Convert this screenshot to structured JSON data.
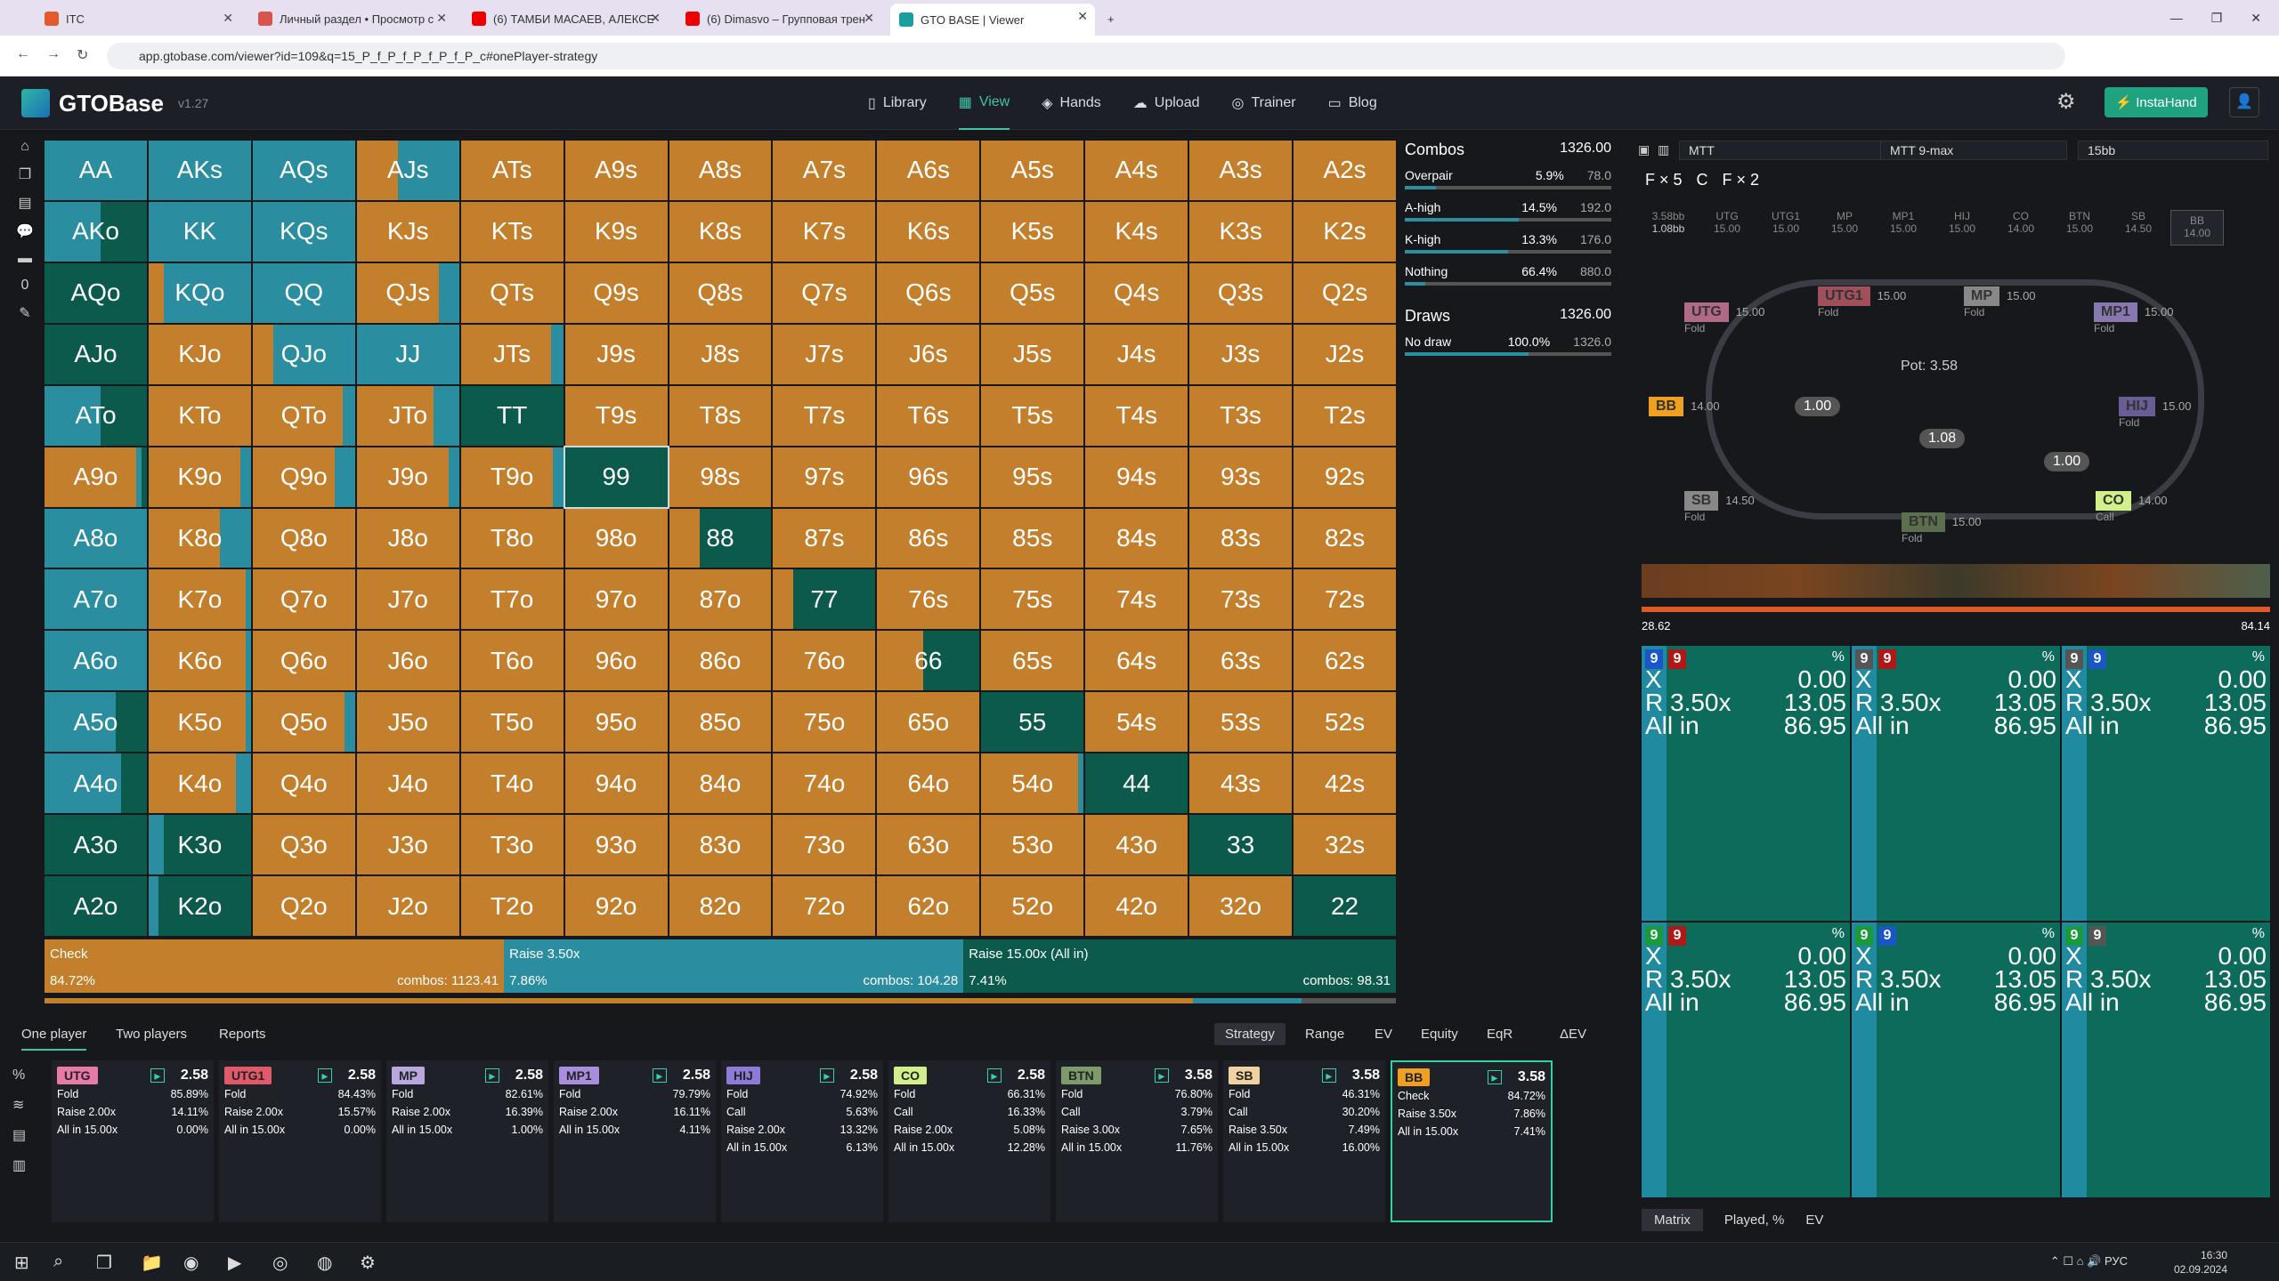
{
  "browser": {
    "tabs": [
      {
        "label": "ITC",
        "color": "#e55a2b",
        "active": false
      },
      {
        "label": "Личный раздел • Просмотр с",
        "color": "#d9534f",
        "active": false
      },
      {
        "label": "(6) ТАМБИ МАСАЕВ, АЛЕКСЕЙ",
        "color": "#e00",
        "active": false
      },
      {
        "label": "(6) Dimasvo – Групповая трен",
        "color": "#e00",
        "active": false
      },
      {
        "label": "GTO BASE | Viewer",
        "color": "#1b9e9e",
        "active": true
      }
    ],
    "url": "app.gtobase.com/viewer?id=109&q=15_P_f_P_f_P_f_P_f_P_c#onePlayer-strategy"
  },
  "app": {
    "name": "GTOBase",
    "version": "v1.27",
    "nav": [
      "Library",
      "View",
      "Hands",
      "Upload",
      "Trainer",
      "Blog"
    ],
    "nav_selected": "View",
    "instahand": "InstaHand"
  },
  "matrix": {
    "colors": {
      "check": "#c47f2c",
      "raise": "#2a8ea0",
      "allin": "#0b5a4c"
    },
    "hands": [
      "AA",
      "AKs",
      "AQs",
      "AJs",
      "ATs",
      "A9s",
      "A8s",
      "A7s",
      "A6s",
      "A5s",
      "A4s",
      "A3s",
      "A2s",
      "AKo",
      "KK",
      "KQs",
      "KJs",
      "KTs",
      "K9s",
      "K8s",
      "K7s",
      "K6s",
      "K5s",
      "K4s",
      "K3s",
      "K2s",
      "AQo",
      "KQo",
      "QQ",
      "QJs",
      "QTs",
      "Q9s",
      "Q8s",
      "Q7s",
      "Q6s",
      "Q5s",
      "Q4s",
      "Q3s",
      "Q2s",
      "AJo",
      "KJo",
      "QJo",
      "JJ",
      "JTs",
      "J9s",
      "J8s",
      "J7s",
      "J6s",
      "J5s",
      "J4s",
      "J3s",
      "J2s",
      "ATo",
      "KTo",
      "QTo",
      "JTo",
      "TT",
      "T9s",
      "T8s",
      "T7s",
      "T6s",
      "T5s",
      "T4s",
      "T3s",
      "T2s",
      "A9o",
      "K9o",
      "Q9o",
      "J9o",
      "T9o",
      "99",
      "98s",
      "97s",
      "96s",
      "95s",
      "94s",
      "93s",
      "92s",
      "A8o",
      "K8o",
      "Q8o",
      "J8o",
      "T8o",
      "98o",
      "88",
      "87s",
      "86s",
      "85s",
      "84s",
      "83s",
      "82s",
      "A7o",
      "K7o",
      "Q7o",
      "J7o",
      "T7o",
      "97o",
      "87o",
      "77",
      "76s",
      "75s",
      "74s",
      "73s",
      "72s",
      "A6o",
      "K6o",
      "Q6o",
      "J6o",
      "T6o",
      "96o",
      "86o",
      "76o",
      "66",
      "65s",
      "64s",
      "63s",
      "62s",
      "A5o",
      "K5o",
      "Q5o",
      "J5o",
      "T5o",
      "95o",
      "85o",
      "75o",
      "65o",
      "55",
      "54s",
      "53s",
      "52s",
      "A4o",
      "K4o",
      "Q4o",
      "J4o",
      "T4o",
      "94o",
      "84o",
      "74o",
      "64o",
      "54o",
      "44",
      "43s",
      "42s",
      "A3o",
      "K3o",
      "Q3o",
      "J3o",
      "T3o",
      "93o",
      "83o",
      "73o",
      "63o",
      "53o",
      "43o",
      "33",
      "32s",
      "A2o",
      "K2o",
      "Q2o",
      "J2o",
      "T2o",
      "92o",
      "82o",
      "72o",
      "62o",
      "52o",
      "42o",
      "32o",
      "22"
    ],
    "mix": {
      "AA": [
        0,
        100,
        0
      ],
      "AKs": [
        0,
        100,
        0
      ],
      "AQs": [
        0,
        100,
        0
      ],
      "AJs": [
        40,
        60,
        0
      ],
      "ATs": [
        100,
        0,
        0
      ],
      "AKo": [
        0,
        55,
        45
      ],
      "KK": [
        0,
        100,
        0
      ],
      "KQs": [
        0,
        100,
        0
      ],
      "KJs": [
        100,
        0,
        0
      ],
      "KTs": [
        100,
        0,
        0
      ],
      "AQo": [
        0,
        0,
        100
      ],
      "KQo": [
        15,
        85,
        0
      ],
      "QQ": [
        0,
        100,
        0
      ],
      "QJs": [
        80,
        20,
        0
      ],
      "QTs": [
        100,
        0,
        0
      ],
      "AJo": [
        0,
        0,
        100
      ],
      "KJo": [
        100,
        0,
        0
      ],
      "QJo": [
        20,
        80,
        0
      ],
      "JJ": [
        0,
        100,
        0
      ],
      "JTs": [
        88,
        12,
        0
      ],
      "ATo": [
        0,
        55,
        45
      ],
      "KTo": [
        100,
        0,
        0
      ],
      "QTo": [
        88,
        12,
        0
      ],
      "JTo": [
        75,
        25,
        0
      ],
      "TT": [
        0,
        0,
        100
      ],
      "A9o": [
        90,
        5,
        5
      ],
      "K9o": [
        90,
        10,
        0
      ],
      "Q9o": [
        80,
        20,
        0
      ],
      "J9o": [
        90,
        10,
        0
      ],
      "T9o": [
        90,
        10,
        0
      ],
      "99": [
        0,
        0,
        100
      ],
      "A8o": [
        0,
        100,
        0
      ],
      "K8o": [
        70,
        30,
        0
      ],
      "88": [
        30,
        0,
        70
      ],
      "A7o": [
        0,
        100,
        0
      ],
      "K7o": [
        95,
        5,
        0
      ],
      "77": [
        20,
        0,
        80
      ],
      "A6o": [
        0,
        100,
        0
      ],
      "K6o": [
        95,
        5,
        0
      ],
      "66": [
        45,
        0,
        55
      ],
      "A5o": [
        0,
        70,
        30
      ],
      "K5o": [
        95,
        5,
        0
      ],
      "Q5o": [
        90,
        10,
        0
      ],
      "55": [
        0,
        0,
        100
      ],
      "A4o": [
        0,
        75,
        25
      ],
      "K4o": [
        85,
        15,
        0
      ],
      "54o": [
        95,
        5,
        0
      ],
      "44": [
        0,
        0,
        100
      ],
      "A3o": [
        0,
        0,
        100
      ],
      "K3o": [
        0,
        15,
        85
      ],
      "Q3o": [
        100,
        0,
        0
      ],
      "33": [
        0,
        0,
        100
      ],
      "A2o": [
        0,
        0,
        100
      ],
      "K2o": [
        0,
        10,
        90
      ],
      "Q2o": [
        100,
        0,
        0
      ],
      "22": [
        0,
        0,
        100
      ]
    },
    "highlighted": "99"
  },
  "actions": [
    {
      "label": "Check",
      "pct": "84.72%",
      "combos": "combos: 1123.41",
      "color": "#c47f2c",
      "width": 34
    },
    {
      "label": "Raise 3.50x",
      "pct": "7.86%",
      "combos": "combos: 104.28",
      "color": "#2a8ea0",
      "width": 34
    },
    {
      "label": "Raise 15.00x (All in)",
      "pct": "7.41%",
      "combos": "combos: 98.31",
      "color": "#0b5a4c",
      "width": 32
    }
  ],
  "combos": {
    "title": "Combos",
    "total": "1326.00",
    "rows": [
      {
        "label": "Overpair",
        "pct": "5.9%",
        "n": "78.0",
        "fill": 15
      },
      {
        "label": "A-high",
        "pct": "14.5%",
        "n": "192.0",
        "fill": 55
      },
      {
        "label": "K-high",
        "pct": "13.3%",
        "n": "176.0",
        "fill": 50
      },
      {
        "label": "Nothing",
        "pct": "66.4%",
        "n": "880.0",
        "fill": 10
      }
    ],
    "draws_title": "Draws",
    "draws_total": "1326.00",
    "draws": [
      {
        "label": "No draw",
        "pct": "100.0%",
        "n": "1326.0",
        "fill": 60
      }
    ]
  },
  "tabs": {
    "left": [
      "One player",
      "Two players",
      "Reports"
    ],
    "left_selected": "One player",
    "right": [
      "Strategy",
      "Range",
      "EV",
      "Equity",
      "EqR",
      "ΔEV"
    ],
    "right_selected": "Strategy"
  },
  "players": [
    {
      "pos": "UTG",
      "color": "#e87aa8",
      "stack": "2.58",
      "lines": [
        [
          "Fold",
          "85.89%"
        ],
        [
          "Raise 2.00x",
          "14.11%"
        ],
        [
          "All in 15.00x",
          "0.00%"
        ]
      ]
    },
    {
      "pos": "UTG1",
      "color": "#e05a6a",
      "stack": "2.58",
      "lines": [
        [
          "Fold",
          "84.43%"
        ],
        [
          "Raise 2.00x",
          "15.57%"
        ],
        [
          "All in 15.00x",
          "0.00%"
        ]
      ]
    },
    {
      "pos": "MP",
      "color": "#b9a8e0",
      "stack": "2.58",
      "lines": [
        [
          "Fold",
          "82.61%"
        ],
        [
          "Raise 2.00x",
          "16.39%"
        ],
        [
          "All in 15.00x",
          "1.00%"
        ]
      ]
    },
    {
      "pos": "MP1",
      "color": "#a98ee0",
      "stack": "2.58",
      "lines": [
        [
          "Fold",
          "79.79%"
        ],
        [
          "Raise 2.00x",
          "16.11%"
        ],
        [
          "All in 15.00x",
          "4.11%"
        ]
      ]
    },
    {
      "pos": "HIJ",
      "color": "#8e7ad8",
      "stack": "2.58",
      "lines": [
        [
          "Fold",
          "74.92%"
        ],
        [
          "Call",
          "5.63%"
        ],
        [
          "Raise 2.00x",
          "13.32%"
        ],
        [
          "All in 15.00x",
          "6.13%"
        ]
      ]
    },
    {
      "pos": "CO",
      "color": "#d2f08a",
      "stack": "2.58",
      "lines": [
        [
          "Fold",
          "66.31%"
        ],
        [
          "Call",
          "16.33%"
        ],
        [
          "Raise 2.00x",
          "5.08%"
        ],
        [
          "All in 15.00x",
          "12.28%"
        ]
      ]
    },
    {
      "pos": "BTN",
      "color": "#7d9a6a",
      "stack": "3.58",
      "lines": [
        [
          "Fold",
          "76.80%"
        ],
        [
          "Call",
          "3.79%"
        ],
        [
          "Raise 3.00x",
          "7.65%"
        ],
        [
          "All in 15.00x",
          "11.76%"
        ]
      ]
    },
    {
      "pos": "SB",
      "color": "#f0d2a0",
      "stack": "3.58",
      "lines": [
        [
          "Fold",
          "46.31%"
        ],
        [
          "Call",
          "30.20%"
        ],
        [
          "Raise 3.50x",
          "7.49%"
        ],
        [
          "All in 15.00x",
          "16.00%"
        ]
      ]
    },
    {
      "pos": "BB",
      "color": "#f0a020",
      "stack": "3.58",
      "active": true,
      "lines": [
        [
          "Check",
          "84.72%"
        ],
        [
          "Raise 3.50x",
          "7.86%"
        ],
        [
          "All in 15.00x",
          "7.41%"
        ]
      ]
    }
  ],
  "right": {
    "selects": [
      "MTT",
      "MTT 9-max",
      "15bb"
    ],
    "fs": [
      "F × 5",
      "C",
      "F × 2"
    ],
    "seats": [
      {
        "l1": "3.58bb",
        "l2": "1.08bb"
      },
      {
        "l1": "UTG",
        "l2": "15.00"
      },
      {
        "l1": "UTG1",
        "l2": "15.00"
      },
      {
        "l1": "MP",
        "l2": "15.00"
      },
      {
        "l1": "MP1",
        "l2": "15.00"
      },
      {
        "l1": "HIJ",
        "l2": "15.00"
      },
      {
        "l1": "CO",
        "l2": "14.00"
      },
      {
        "l1": "BTN",
        "l2": "15.00"
      },
      {
        "l1": "SB",
        "l2": "14.50"
      },
      {
        "l1": "BB",
        "l2": "14.00"
      }
    ],
    "pot": "Pot: 3.58",
    "table_players": [
      {
        "pos": "UTG",
        "stack": "15.00",
        "act": "Fold",
        "color": "#b06a88"
      },
      {
        "pos": "UTG1",
        "stack": "15.00",
        "act": "Fold",
        "color": "#a0505a"
      },
      {
        "pos": "MP",
        "stack": "15.00",
        "act": "Fold",
        "color": "#888"
      },
      {
        "pos": "MP1",
        "stack": "15.00",
        "act": "Fold",
        "color": "#8878b0"
      },
      {
        "pos": "HIJ",
        "stack": "15.00",
        "act": "Fold",
        "color": "#6a5c94"
      },
      {
        "pos": "BB",
        "stack": "14.00",
        "act": "",
        "color": "#f0a020"
      },
      {
        "pos": "SB",
        "stack": "14.50",
        "act": "Fold",
        "color": "#888"
      },
      {
        "pos": "BTN",
        "stack": "15.00",
        "act": "Fold",
        "color": "#5c7050"
      },
      {
        "pos": "CO",
        "stack": "14.00",
        "act": "Call",
        "color": "#d2f08a"
      }
    ],
    "chips": [
      "1.00",
      "1.08",
      "1.00"
    ],
    "hist_min": "28.62",
    "hist_max": "84.14",
    "cards": [
      {
        "c1": "9",
        "c1c": "#1a56c8",
        "c2": "9",
        "c2c": "#b01818"
      },
      {
        "c1": "9",
        "c1c": "#555",
        "c2": "9",
        "c2c": "#b01818"
      },
      {
        "c1": "9",
        "c1c": "#555",
        "c2": "9",
        "c2c": "#1a56c8"
      },
      {
        "c1": "9",
        "c1c": "#1a9a3a",
        "c2": "9",
        "c2c": "#b01818"
      },
      {
        "c1": "9",
        "c1c": "#1a9a3a",
        "c2": "9",
        "c2c": "#1a56c8"
      },
      {
        "c1": "9",
        "c1c": "#1a9a3a",
        "c2": "9",
        "c2c": "#555"
      }
    ],
    "card_rows": [
      [
        "X",
        "0.00"
      ],
      [
        "R 3.50x",
        "13.05"
      ],
      [
        "All in",
        "86.95"
      ]
    ],
    "pct_label": "%",
    "bottom_tabs": [
      "Matrix",
      "Played, %",
      "EV"
    ]
  },
  "taskbar": {
    "lang": "РУС",
    "time": "16:30",
    "date": "02.09.2024"
  }
}
